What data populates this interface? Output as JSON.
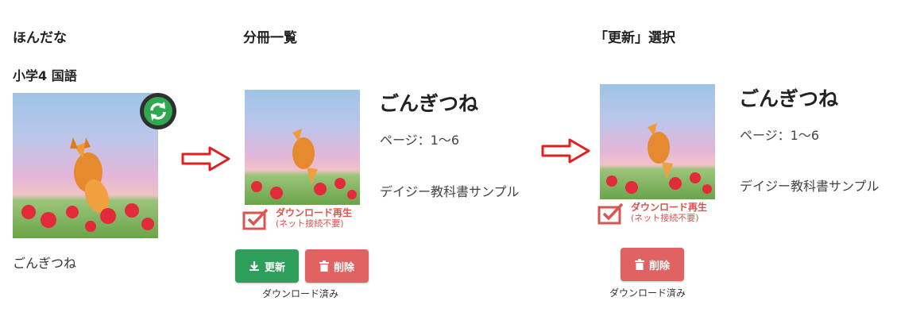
{
  "section1": {
    "title": "ほんだな",
    "subject": "小学4 国語",
    "book_caption": "ごんぎつね"
  },
  "section2": {
    "title": "分冊一覧",
    "book_title": "ごんぎつね",
    "pages": "ページ：1～6",
    "publisher": "デイジー教科書サンプル",
    "checkbox_label": "ダウンロード再生",
    "checkbox_note": "(ネット接続不要)",
    "update_button": "更新",
    "delete_button": "削除",
    "downloaded_status": "ダウンロード済み"
  },
  "section3": {
    "title": "「更新」選択",
    "book_title": "ごんぎつね",
    "pages": "ページ：1～6",
    "publisher": "デイジー教科書サンプル",
    "checkbox_label": "ダウンロード再生",
    "checkbox_note": "(ネット接続不要)",
    "delete_button": "削除",
    "downloaded_status": "ダウンロード済み"
  },
  "icons": [
    "sync-icon",
    "arrow-right-icon",
    "play-icon",
    "checkbox-checked-icon",
    "download-icon",
    "trash-icon"
  ],
  "colors": {
    "green": "#2e9e5b",
    "red": "#e06262",
    "arrow_red": "#e02020"
  }
}
